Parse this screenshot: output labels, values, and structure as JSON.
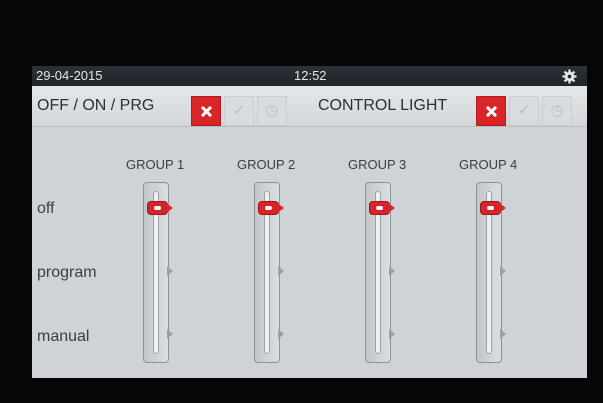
{
  "status": {
    "date": "29-04-2015",
    "time": "12:52",
    "settings_icon": "gear-icon"
  },
  "controls": {
    "off_on_prg": {
      "label": "OFF / ON / PRG",
      "buttons": [
        "off-x-icon",
        "on-check-icon",
        "program-clock-icon"
      ]
    },
    "control_light": {
      "label": "CONTROL LIGHT",
      "buttons": [
        "off-x-icon",
        "on-check-icon",
        "program-clock-icon"
      ]
    }
  },
  "rows": [
    "off",
    "program",
    "manual"
  ],
  "groups": [
    {
      "name": "GROUP 1",
      "mode": "off"
    },
    {
      "name": "GROUP 2",
      "mode": "off"
    },
    {
      "name": "GROUP 3",
      "mode": "off"
    },
    {
      "name": "GROUP 4",
      "mode": "off"
    }
  ],
  "colors": {
    "accent": "#d92428",
    "statusbar": "#232a30",
    "panel": "#cfd3d7"
  }
}
